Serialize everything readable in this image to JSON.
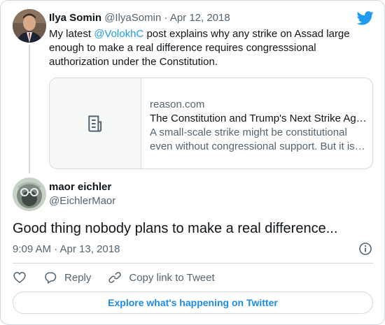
{
  "parent_tweet": {
    "author_name": "Ilya Somin",
    "handle": "@IlyaSomin",
    "separator": "·",
    "date": "Apr 12, 2018",
    "text_before": "My latest ",
    "mention": "@VolokhC",
    "text_after": " post explains why any strike on Assad large enough to make a real difference requires congresssional authorization under the Constitution.",
    "link_card": {
      "domain": "reason.com",
      "title": "The Constitution and Trump's Next Strike Against Syria",
      "description": "A small-scale strike might be constitutional even without congressional support. But it is unlikely to make much difference.",
      "thumb_icon": "document-icon"
    }
  },
  "reply_tweet": {
    "author_name": "maor eichler",
    "handle": "@EichlerMaor",
    "text": "Good thing nobody plans to make a real difference...",
    "timestamp": "9:09 AM · Apr 13, 2018"
  },
  "actions": {
    "like_icon": "heart-icon",
    "reply_label": "Reply",
    "copy_label": "Copy link to Tweet"
  },
  "explore_label": "Explore what's happening on Twitter",
  "colors": {
    "accent": "#1d9bf0",
    "muted": "#536471",
    "border": "#cfd9de"
  }
}
